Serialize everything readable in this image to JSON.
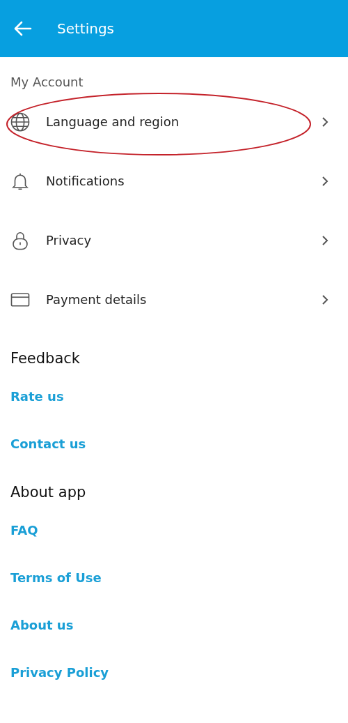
{
  "header": {
    "title": "Settings"
  },
  "sections": [
    {
      "title": "My Account",
      "kind": "menu",
      "items": [
        {
          "label": "Language and region",
          "kind": "globe",
          "highlighted": true
        },
        {
          "label": "Notifications",
          "kind": "bell",
          "highlighted": false
        },
        {
          "label": "Privacy",
          "kind": "lock",
          "highlighted": false
        },
        {
          "label": "Payment details",
          "kind": "card",
          "highlighted": false
        }
      ]
    },
    {
      "title": "Feedback",
      "kind": "links",
      "items": [
        {
          "label": "Rate us"
        },
        {
          "label": "Contact us"
        }
      ]
    },
    {
      "title": "About app",
      "kind": "links",
      "items": [
        {
          "label": "FAQ"
        },
        {
          "label": "Terms of Use"
        },
        {
          "label": "About us"
        },
        {
          "label": "Privacy Policy"
        }
      ]
    }
  ]
}
